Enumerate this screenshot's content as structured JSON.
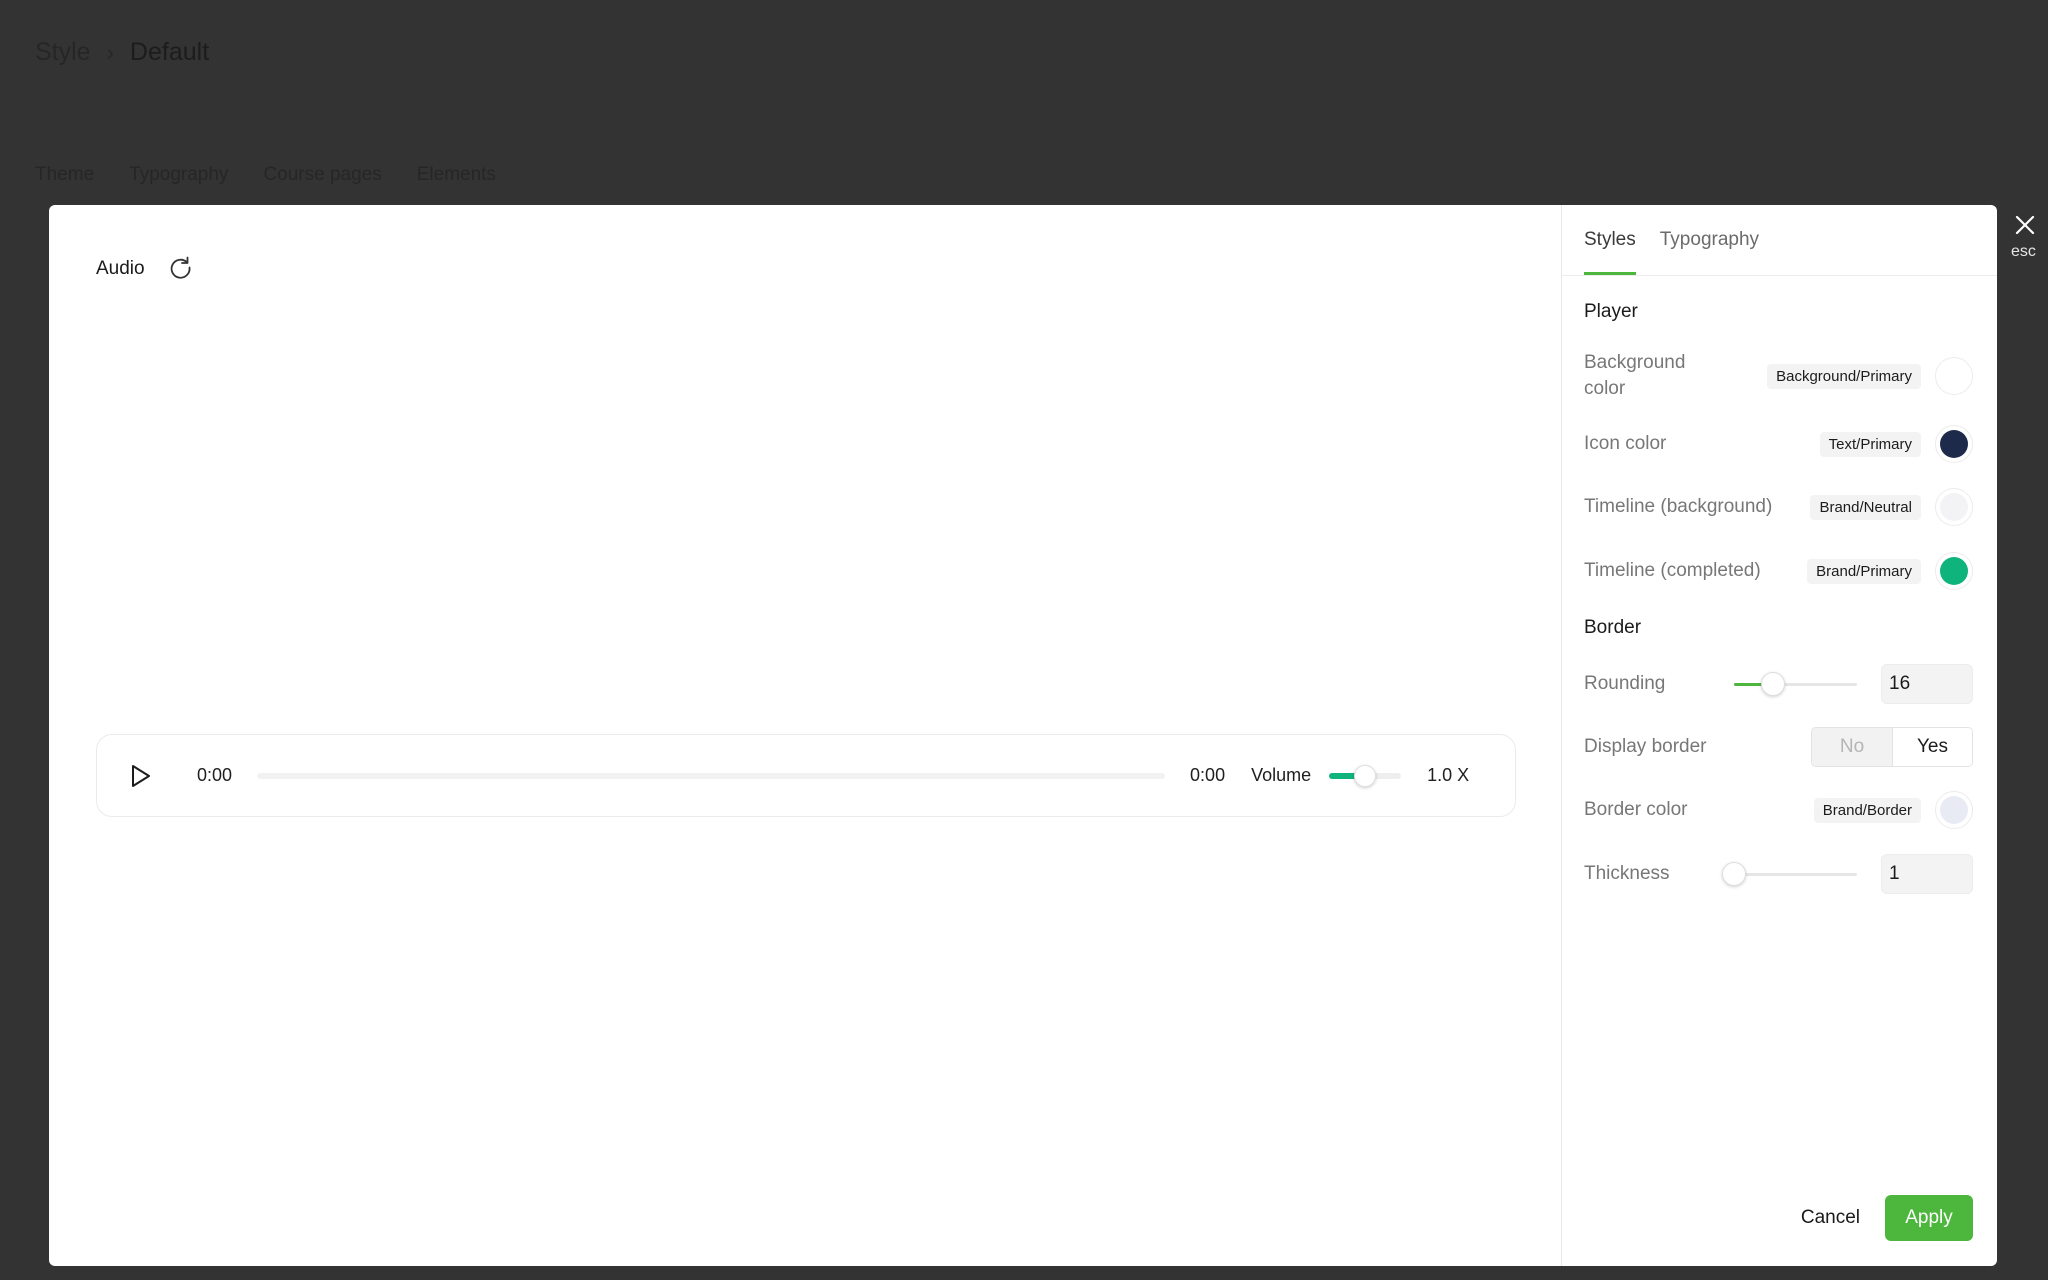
{
  "background": {
    "breadcrumb": {
      "root": "Style",
      "current": "Default"
    },
    "tabs": [
      "Theme",
      "Typography",
      "Course pages",
      "Elements"
    ]
  },
  "close": {
    "label": "esc"
  },
  "preview": {
    "title": "Audio",
    "player": {
      "current_time": "0:00",
      "duration": "0:00",
      "progress": 0,
      "volume_label": "Volume",
      "volume_level": 0.5,
      "speed": "1.0 X"
    }
  },
  "panel": {
    "tabs": {
      "styles": "Styles",
      "typography": "Typography"
    },
    "player_section": {
      "title": "Player",
      "background_color": {
        "label": "Background color",
        "token": "Background/Primary",
        "color": "#ffffff"
      },
      "icon_color": {
        "label": "Icon color",
        "token": "Text/Primary",
        "color": "#1e2a4a"
      },
      "timeline_background": {
        "label": "Timeline (background)",
        "token": "Brand/Neutral",
        "color": "#f3f3f5"
      },
      "timeline_completed": {
        "label": "Timeline (completed)",
        "token": "Brand/Primary",
        "color": "#0fb47c"
      }
    },
    "border_section": {
      "title": "Border",
      "rounding": {
        "label": "Rounding",
        "value": "16",
        "level": 0.32
      },
      "display_border": {
        "label": "Display border",
        "no": "No",
        "yes": "Yes",
        "selected": "Yes"
      },
      "border_color": {
        "label": "Border color",
        "token": "Brand/Border",
        "color": "#e8ebf3"
      },
      "thickness": {
        "label": "Thickness",
        "value": "1",
        "level": 0
      }
    },
    "footer": {
      "cancel": "Cancel",
      "apply": "Apply"
    }
  }
}
